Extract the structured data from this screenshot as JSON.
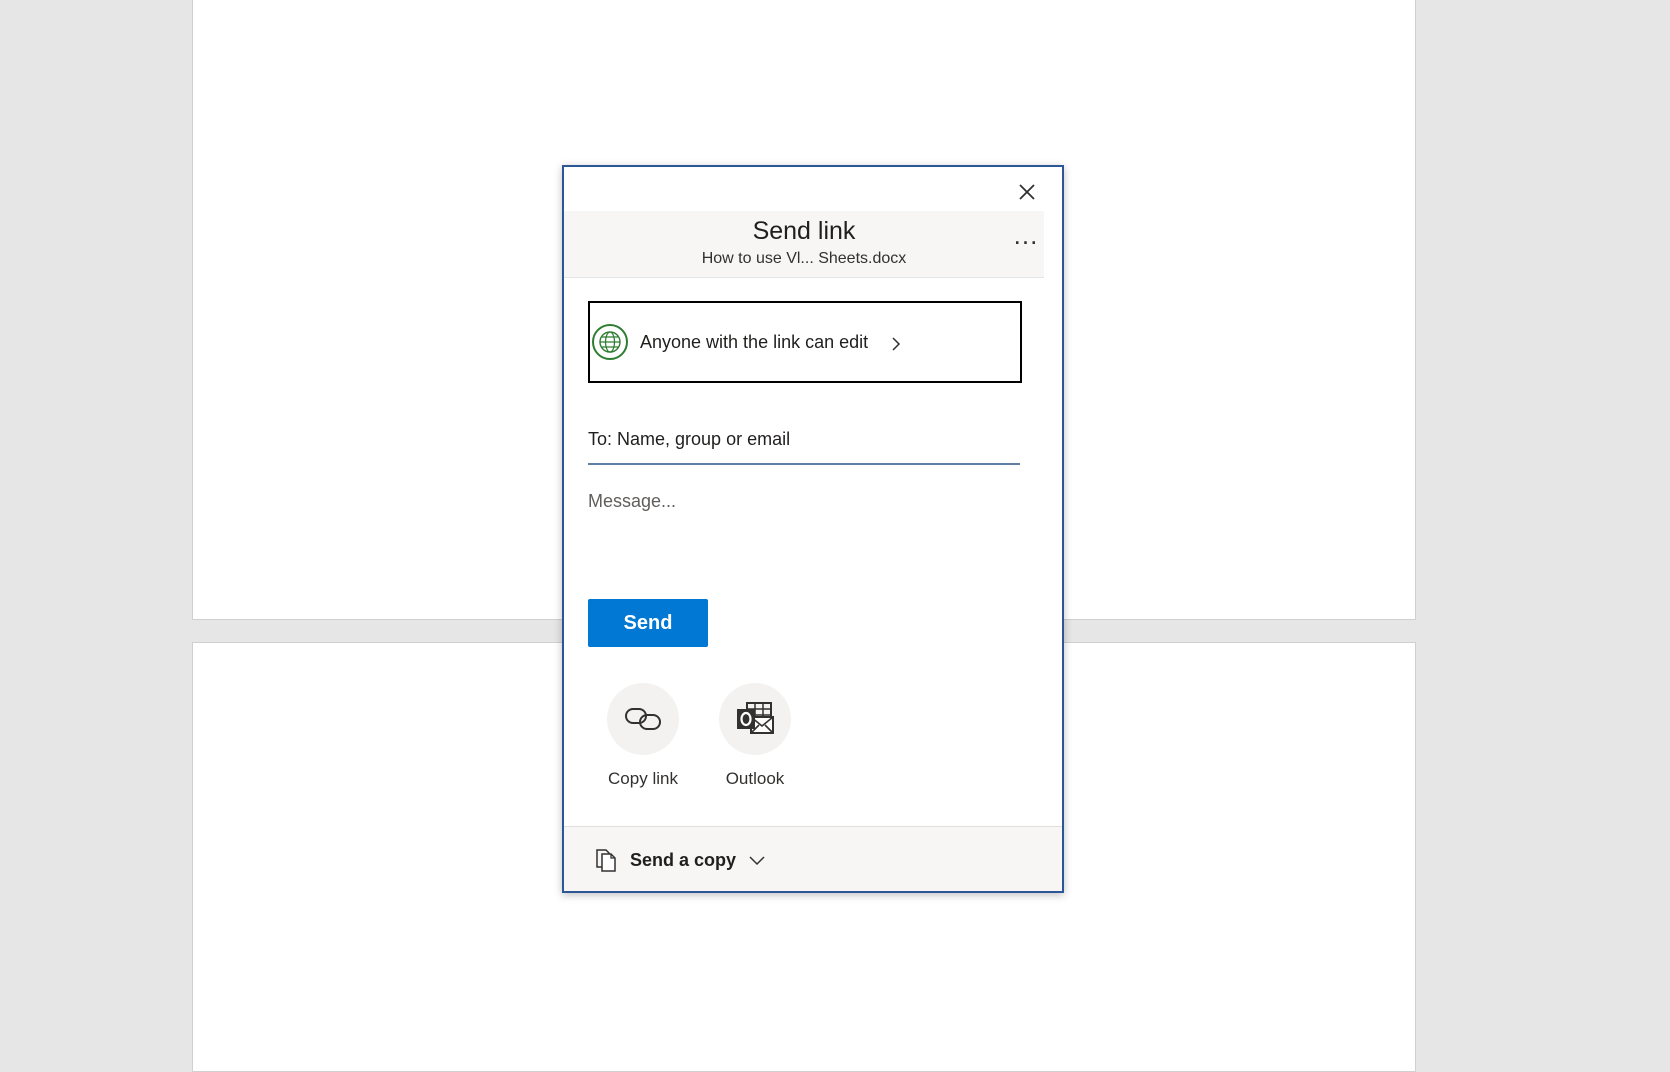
{
  "dialog": {
    "title": "Send link",
    "subtitle": "How to use Vl... Sheets.docx",
    "close_icon": "close-icon",
    "more_label": "...",
    "permission": {
      "icon": "globe-icon",
      "label": "Anyone with the link can edit"
    },
    "to_field": {
      "placeholder": "To: Name, group or email"
    },
    "message_field": {
      "placeholder": "Message..."
    },
    "send_label": "Send",
    "share_options": [
      {
        "icon": "link-icon",
        "label": "Copy link"
      },
      {
        "icon": "outlook-icon",
        "label": "Outlook"
      }
    ],
    "footer": {
      "icon": "copy-document-icon",
      "label": "Send a copy"
    }
  },
  "colors": {
    "accent": "#0078d4",
    "dialog_border": "#2b5797",
    "globe": "#2f7d32",
    "header_bg": "#f7f6f5",
    "workspace_bg": "#e6e6e6"
  }
}
